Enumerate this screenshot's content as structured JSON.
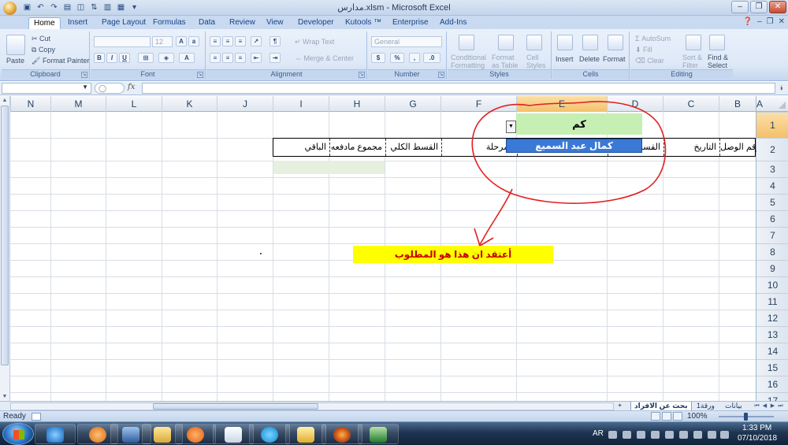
{
  "window": {
    "title": "مدارس.xlsm - Microsoft Excel",
    "qat_icons": [
      "office-button-icon",
      "save-icon",
      "undo-icon",
      "redo-icon",
      "print-icon",
      "preview-icon",
      "sort-icon",
      "chart-icon",
      "form-icon",
      "customize-qat-icon"
    ]
  },
  "ribbon": {
    "tabs": [
      "Home",
      "Insert",
      "Page Layout",
      "Formulas",
      "Data",
      "Review",
      "View",
      "Developer",
      "Kutools ™",
      "Enterprise",
      "Add-Ins"
    ],
    "active_tab": "Home",
    "clipboard": {
      "paste": "Paste",
      "cut": "Cut",
      "copy": "Copy",
      "format_painter": "Format Painter",
      "label": "Clipboard"
    },
    "font": {
      "size": "12",
      "label": "Font",
      "bold": "B",
      "italic": "I",
      "underline": "U"
    },
    "alignment": {
      "wrap_text": "Wrap Text",
      "merge_center": "Merge & Center",
      "label": "Alignment"
    },
    "number": {
      "format": "General",
      "label": "Number",
      "currency": "$",
      "percent": "%"
    },
    "styles": {
      "conditional": "Conditional",
      "conditional2": "Formatting",
      "format": "Format",
      "format2": "as Table",
      "cell": "Cell",
      "cell2": "Styles",
      "label": "Styles"
    },
    "cells": {
      "insert": "Insert",
      "delete": "Delete",
      "format": "Format",
      "label": "Cells"
    },
    "editing": {
      "autosum": "AutoSum",
      "fill": "Fill",
      "clear": "Clear",
      "sort": "Sort &",
      "sort2": "Filter",
      "find": "Find &",
      "find2": "Select",
      "label": "Editing"
    }
  },
  "formula_bar": {
    "name_box": "",
    "formula": "",
    "fx": "fx"
  },
  "sheet": {
    "column_headers": [
      "N",
      "M",
      "L",
      "K",
      "J",
      "I",
      "H",
      "G",
      "F",
      "E",
      "D",
      "C",
      "B"
    ],
    "col_a": "A",
    "row_headers": [
      "1",
      "2",
      "3",
      "4",
      "5",
      "6",
      "7",
      "8",
      "9",
      "10",
      "11",
      "12",
      "13",
      "14",
      "15",
      "16",
      "17"
    ],
    "selected_column": "E",
    "selected_row": "1",
    "active_cell_value": "كم",
    "dropdown_option": "كمال عبد السميع",
    "header_row": {
      "I": "الباقي",
      "H": "مجموع مادفعه",
      "G": "القسط الكلي",
      "F": "المرحلة",
      "D": "القسط",
      "C": "التاريخ",
      "B": "رقم الوصل"
    },
    "callout_text": "أعتقد ان هذا هو المطلوب"
  },
  "sheet_tabs": [
    "بحث عن الافراد",
    "ورقة1",
    "بيانات"
  ],
  "status_bar": {
    "ready": "Ready",
    "zoom": "100%"
  },
  "taskbar": {
    "language": "AR",
    "time": "1:33 PM",
    "date": "07/10/2018",
    "apps": [
      "ie-icon",
      "media-icon",
      "network-icon",
      "folder-icon",
      "player-icon",
      "window-icon",
      "skype-icon",
      "explorer-icon",
      "firefox-icon",
      "excel-icon"
    ]
  },
  "colors": {
    "active_cell_green": "#c6efb4",
    "dropdown_blue": "#3a7ad6",
    "callout_yellow": "#ffff00",
    "callout_text_red": "#c40000",
    "annotation_red": "#e02020"
  }
}
